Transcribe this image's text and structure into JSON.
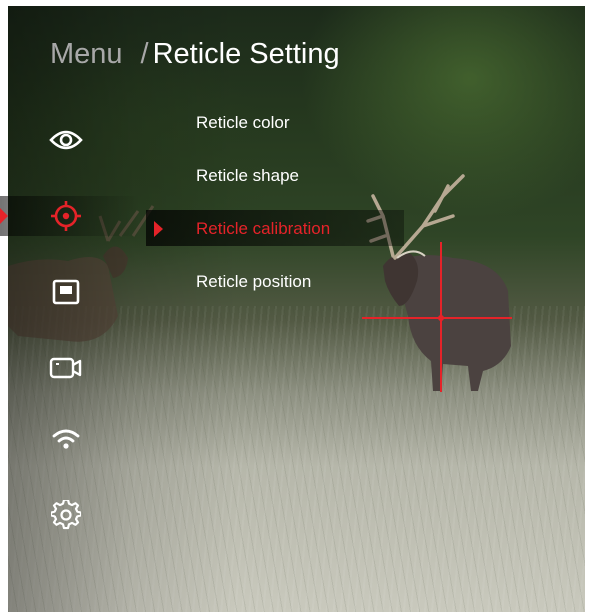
{
  "header": {
    "menu_label": "Menu",
    "separator": "/",
    "title": "Reticle Setting"
  },
  "sidebar": {
    "items": [
      {
        "icon": "eye-icon",
        "selected": false
      },
      {
        "icon": "reticle-crosshair-icon",
        "selected": true
      },
      {
        "icon": "picture-in-picture-icon",
        "selected": false
      },
      {
        "icon": "video-camera-icon",
        "selected": false
      },
      {
        "icon": "wifi-icon",
        "selected": false
      },
      {
        "icon": "gear-icon",
        "selected": false
      }
    ]
  },
  "submenu": {
    "items": [
      {
        "label": "Reticle color",
        "active": false
      },
      {
        "label": "Reticle shape",
        "active": false
      },
      {
        "label": "Reticle calibration",
        "active": true
      },
      {
        "label": "Reticle position",
        "active": false
      }
    ]
  },
  "colors": {
    "accent": "#e52329",
    "text": "#ffffff",
    "muted": "#a8a8a8"
  }
}
